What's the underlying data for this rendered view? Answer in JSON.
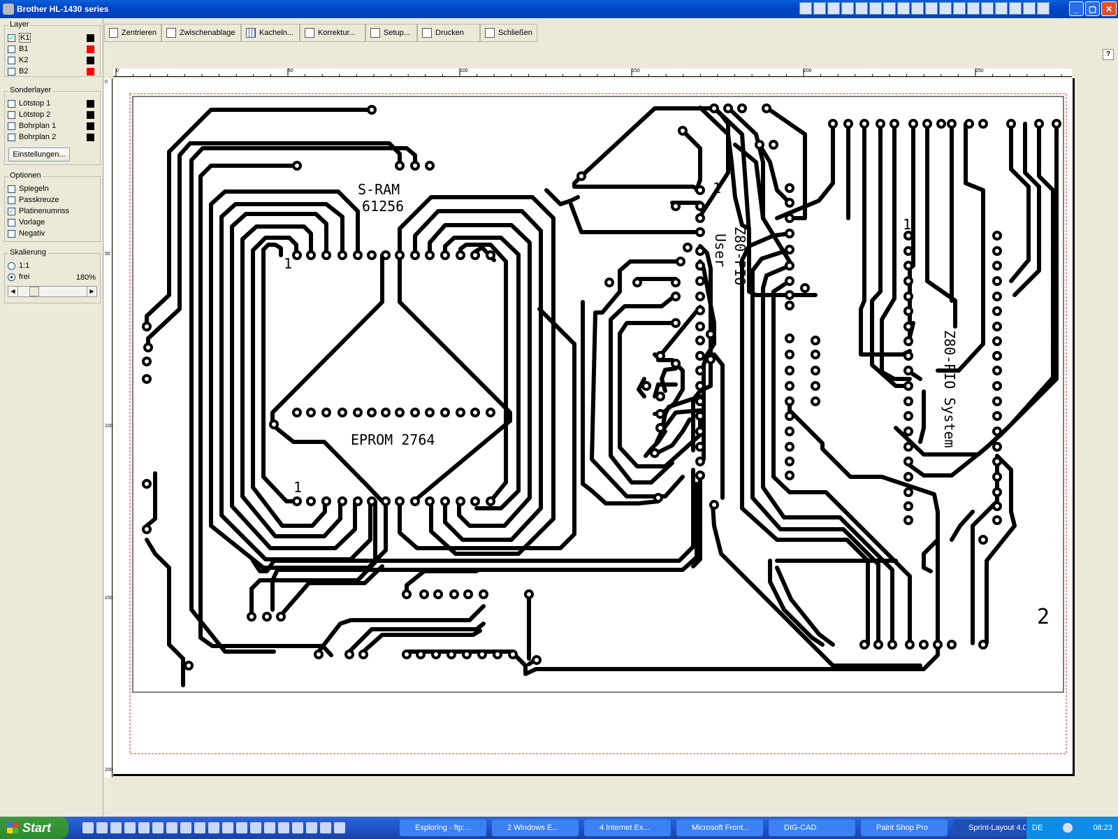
{
  "window": {
    "title": "Brother HL-1430 series"
  },
  "layers": {
    "title": "Layer",
    "items": [
      {
        "label": "K1",
        "checked": true,
        "color": "#000000"
      },
      {
        "label": "B1",
        "checked": false,
        "color": "#ff0000"
      },
      {
        "label": "K2",
        "checked": false,
        "color": "#000000"
      },
      {
        "label": "B2",
        "checked": false,
        "color": "#ff0000"
      }
    ]
  },
  "special_layers": {
    "title": "Sonderlayer",
    "items": [
      {
        "label": "Lötstop 1",
        "checked": false,
        "color": "#000000"
      },
      {
        "label": "Lötstop 2",
        "checked": false,
        "color": "#000000"
      },
      {
        "label": "Bohrplan 1",
        "checked": false,
        "color": "#000000"
      },
      {
        "label": "Bohrplan 2",
        "checked": false,
        "color": "#000000"
      }
    ],
    "settings_button": "Einstellungen..."
  },
  "options": {
    "title": "Optionen",
    "items": [
      {
        "label": "Spiegeln",
        "checked": false
      },
      {
        "label": "Passkreuze",
        "checked": false
      },
      {
        "label": "Platinenumriss",
        "checked": true
      },
      {
        "label": "Vorlage",
        "checked": false
      },
      {
        "label": "Negativ",
        "checked": false
      }
    ]
  },
  "scaling": {
    "title": "Skalierung",
    "opt1": "1:1",
    "opt2": "frei",
    "value": "180%",
    "selected": "frei"
  },
  "toolbar": {
    "buttons": [
      {
        "label": "Zentrieren",
        "icon": "center-icon"
      },
      {
        "label": "Zwischenablage",
        "icon": "clipboard-icon"
      },
      {
        "label": "Kacheln...",
        "icon": "tiles-icon"
      },
      {
        "label": "Korrektur...",
        "icon": "correction-icon"
      },
      {
        "label": "Setup...",
        "icon": "setup-icon"
      },
      {
        "label": "Drucken",
        "icon": "printer-icon"
      },
      {
        "label": "Schließen",
        "icon": "close-doc-icon"
      }
    ],
    "help": "?"
  },
  "ruler": {
    "h_labels": [
      "0",
      "50",
      "100",
      "150",
      "200",
      "250"
    ],
    "v_labels": [
      "0",
      "50",
      "100",
      "150",
      "200"
    ]
  },
  "pcb": {
    "labels": {
      "sram": "S-RAM",
      "sram_part": "61256",
      "eprom": "EPROM 2764",
      "pin1_a": "1",
      "pin1_b": "1",
      "pin1_c": "1",
      "pin1_d": "1",
      "z80_user_1": "Z80-PIO",
      "z80_user_2": "User",
      "z80_system": "Z80-PIO System",
      "board_number": "2"
    }
  },
  "taskbar": {
    "start": "Start",
    "tasks": [
      {
        "label": "Exploring - ftp:...",
        "active": false
      },
      {
        "label": "2 Windows E...",
        "active": false
      },
      {
        "label": "4 Internet Ex...",
        "active": false
      },
      {
        "label": "Microsoft Front...",
        "active": false
      },
      {
        "label": "DIG-CAD",
        "active": false
      },
      {
        "label": "Paint Shop Pro",
        "active": false
      },
      {
        "label": "Sprint-Layout 4.0",
        "active": true
      }
    ],
    "tray": {
      "lang": "DE",
      "time": "08:23"
    }
  }
}
